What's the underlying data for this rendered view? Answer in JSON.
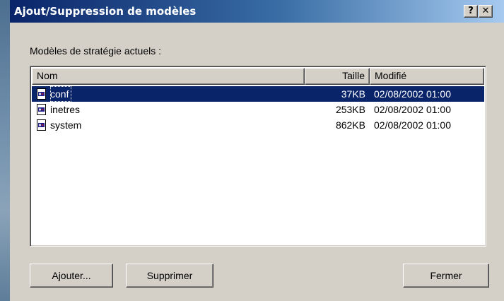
{
  "window": {
    "title": "Ajout/Suppression de modèles",
    "help_glyph": "?",
    "close_glyph": "✕"
  },
  "section_label": "Modèles de stratégie actuels :",
  "columns": {
    "name": "Nom",
    "size": "Taille",
    "modified": "Modifié"
  },
  "rows": [
    {
      "name": "conf",
      "size": "37KB",
      "modified": "02/08/2002 01:00",
      "icon": "adm-template-icon",
      "selected": true
    },
    {
      "name": "inetres",
      "size": "253KB",
      "modified": "02/08/2002 01:00",
      "icon": "adm-template-icon",
      "selected": false
    },
    {
      "name": "system",
      "size": "862KB",
      "modified": "02/08/2002 01:00",
      "icon": "adm-template-icon",
      "selected": false
    }
  ],
  "buttons": {
    "add": "Ajouter...",
    "remove": "Supprimer",
    "close": "Fermer"
  },
  "colors": {
    "title_gradient_start": "#0a246a",
    "title_gradient_end": "#a6caf0",
    "selection": "#0a246a",
    "face": "#d4d0c8"
  }
}
